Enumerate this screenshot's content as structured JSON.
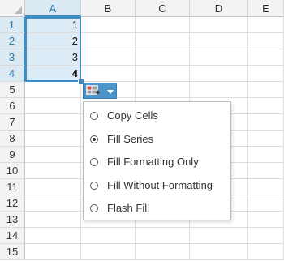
{
  "columns": [
    "A",
    "B",
    "C",
    "D",
    "E"
  ],
  "rows": [
    "1",
    "2",
    "3",
    "4",
    "5",
    "6",
    "7",
    "8",
    "9",
    "10",
    "11",
    "12",
    "13",
    "14",
    "15"
  ],
  "selected_column": "A",
  "selected_rows": [
    "1",
    "2",
    "3",
    "4"
  ],
  "cells": {
    "A1": "1",
    "A2": "2",
    "A3": "3",
    "A4": "4"
  },
  "autofill_options": {
    "button_icon": "autofill-options-icon",
    "items": [
      {
        "label": "Copy Cells",
        "checked": false
      },
      {
        "label": "Fill Series",
        "checked": true
      },
      {
        "label": "Fill Formatting Only",
        "checked": false
      },
      {
        "label": "Fill Without Formatting",
        "checked": false
      },
      {
        "label": "Flash Fill",
        "checked": false
      }
    ]
  },
  "colors": {
    "selection_accent": "#3e8ec4",
    "selection_fill": "#dcebf5",
    "header_bg": "#f3f3f3",
    "autofill_button": "#4d94c8"
  }
}
